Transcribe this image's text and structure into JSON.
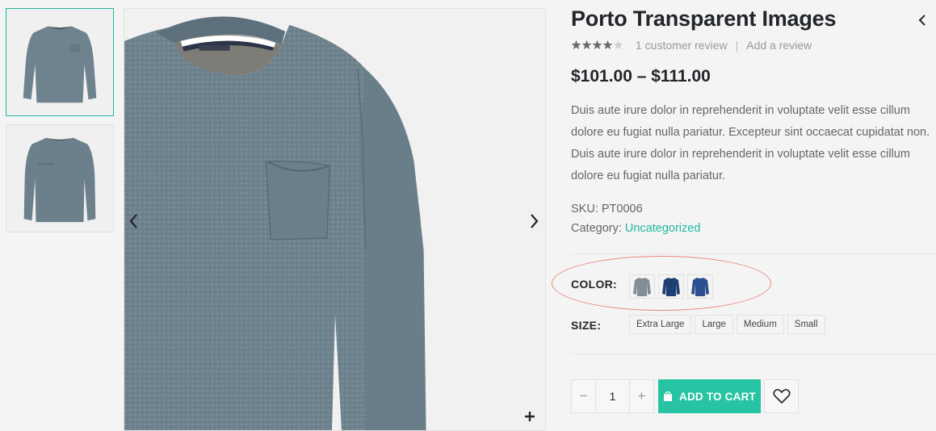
{
  "gallery": {
    "thumbnails": [
      {
        "icon": "sweater-front-thumbnail",
        "active": true
      },
      {
        "icon": "sweater-alt-thumbnail",
        "active": false
      }
    ],
    "main_image_icon": "sweater-photo",
    "prev_icon": "chevron-left-icon",
    "next_icon": "chevron-right-icon",
    "zoom_icon": "plus-icon"
  },
  "product": {
    "title": "Porto Transparent Images",
    "rating": 4,
    "rating_max": 5,
    "review_link": "1 customer review",
    "separator": "|",
    "add_review_link": "Add a review",
    "price": "$101.00 – $111.00",
    "description_lines": [
      "Duis aute irure dolor in reprehenderit in voluptate velit esse cillum",
      "dolore eu fugiat nulla pariatur. Excepteur sint occaecat cupidatat non.",
      "Duis aute irure dolor in reprehenderit in voluptate velit esse cillum",
      "dolore eu fugiat nulla pariatur."
    ],
    "sku_label": "SKU:",
    "sku": "PT0006",
    "category_label": "Category:",
    "category": "Uncategorized"
  },
  "variations": {
    "color_label": "COLOR:",
    "colors": [
      {
        "icon": "sweater-swatch-icon",
        "color": "#7f8e98"
      },
      {
        "icon": "sweater-swatch-icon",
        "color": "#1e3f73"
      },
      {
        "icon": "sweater-swatch-icon",
        "color": "#2c4f8f"
      }
    ],
    "size_label": "SIZE:",
    "sizes": [
      "Extra Large",
      "Large",
      "Medium",
      "Small"
    ]
  },
  "cart": {
    "minus": "−",
    "quantity": "1",
    "plus": "+",
    "add_to_cart": "ADD TO CART",
    "cart_icon": "shopping-bag-icon",
    "wishlist_icon": "heart-icon"
  },
  "colors": {
    "accent": "#27c4a3",
    "link": "#1fb8a0",
    "highlight": "#e8867a",
    "sweater": "#6f838e"
  }
}
